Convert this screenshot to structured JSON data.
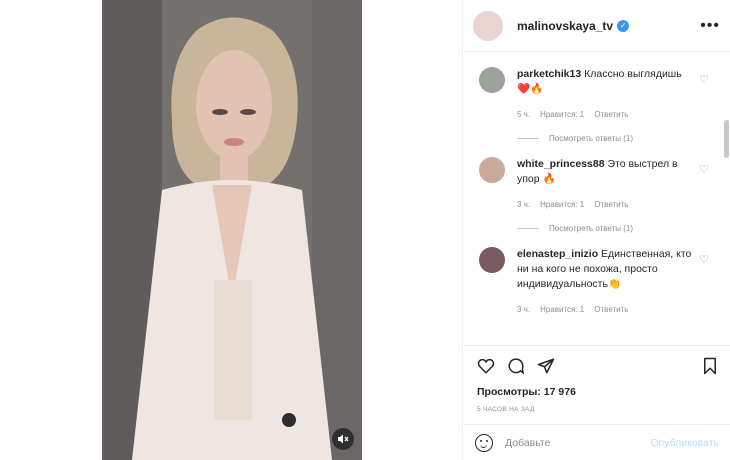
{
  "post": {
    "username": "malinovskaya_tv",
    "more_label": "•••"
  },
  "comments": [
    {
      "user": "parketchik13",
      "text": "Классно выглядишь❤️🔥",
      "time": "5 ч.",
      "likes": "Нравится: 1",
      "reply": "Ответить",
      "replies": "Посмотреть ответы (1)"
    },
    {
      "user": "white_princess88",
      "text": "Это выстрел в упор 🔥",
      "time": "3 ч.",
      "likes": "Нравится: 1",
      "reply": "Ответить",
      "replies": "Посмотреть ответы (1)"
    },
    {
      "user": "elenastep_inizio",
      "text": "Единственная, кто ни на кого не похожа, просто индивидуальность👏",
      "time": "3 ч.",
      "likes": "Нравится: 1",
      "reply": "Ответить"
    }
  ],
  "stats": {
    "views": "Просмотры: 17 976",
    "time": "5 ЧАСОВ НА ЗАД"
  },
  "composer": {
    "placeholder": "Добавьте",
    "publish": "Опубликовать"
  },
  "colors": {
    "verified": "#3897f0",
    "publish_disabled": "#b3dbff"
  }
}
